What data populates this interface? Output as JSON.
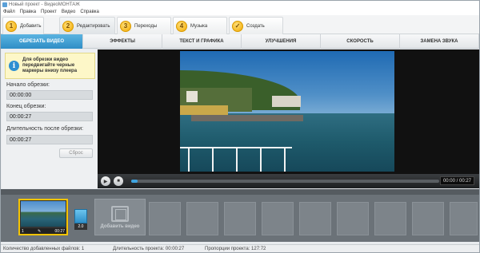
{
  "window": {
    "title": "Новый проект - ВидеоМОНТАЖ"
  },
  "menu": [
    "Файл",
    "Правка",
    "Проект",
    "Видео",
    "Справка"
  ],
  "steps": [
    {
      "num": "1",
      "label": "Добавить"
    },
    {
      "num": "2",
      "label": "Редактировать"
    },
    {
      "num": "3",
      "label": "Переходы"
    },
    {
      "num": "4",
      "label": "Музыка"
    },
    {
      "num": "✓",
      "label": "Создать"
    }
  ],
  "subtabs": [
    "Обрезать видео",
    "Эффекты",
    "Текст и графика",
    "Улучшения",
    "Скорость",
    "Замена звука"
  ],
  "trim": {
    "hint": "Для обрезки видео передвигайте черные маркеры внизу плеера",
    "start_label": "Начало обрезки:",
    "start_value": "00:00:00",
    "end_label": "Конец обрезки:",
    "end_value": "00:00:27",
    "duration_label": "Длительность после обрезки:",
    "duration_value": "00:00:27",
    "reset_label": "Сброс"
  },
  "player": {
    "time": "00:00 / 00:27",
    "progress": 0.0
  },
  "timeline": {
    "clip_number": "1",
    "clip_duration": "00:27",
    "transition_duration": "2.0",
    "add_video_label": "Добавить видео"
  },
  "status": {
    "files": "Количество добавленных файлов: 1",
    "duration": "Длительность проекта: 00:00:27",
    "aspect": "Пропорции проекта: 127:72"
  },
  "colors": {
    "accent": "#2f8ec6",
    "step": "#f2a900",
    "clip_border": "#f5c400"
  }
}
